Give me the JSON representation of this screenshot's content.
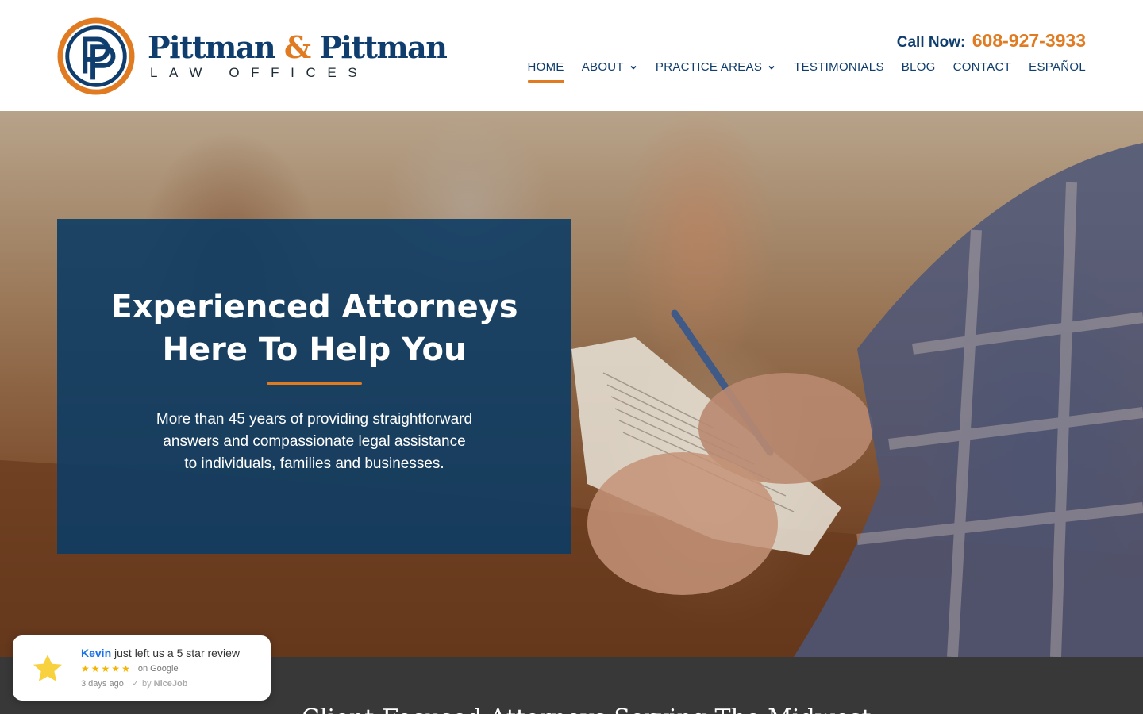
{
  "brand": {
    "name_part1": "Pittman",
    "name_amp": "&",
    "name_part2": "Pittman",
    "subtitle": "LAW OFFICES",
    "logo_letters": "PP",
    "colors": {
      "navy": "#0f3e6e",
      "orange": "#e07b22"
    }
  },
  "header": {
    "call_label": "Call Now:",
    "call_number": "608-927-3933"
  },
  "nav": {
    "items": [
      {
        "label": "HOME",
        "active": true,
        "has_dropdown": false
      },
      {
        "label": "ABOUT",
        "active": false,
        "has_dropdown": true
      },
      {
        "label": "PRACTICE AREAS",
        "active": false,
        "has_dropdown": true
      },
      {
        "label": "TESTIMONIALS",
        "active": false,
        "has_dropdown": false
      },
      {
        "label": "BLOG",
        "active": false,
        "has_dropdown": false
      },
      {
        "label": "CONTACT",
        "active": false,
        "has_dropdown": false
      },
      {
        "label": "ESPAÑOL",
        "active": false,
        "has_dropdown": false
      }
    ]
  },
  "hero": {
    "title": "Experienced Attorneys Here To Help You",
    "description": "More than 45 years of providing straightforward answers and compassionate legal assistance to individuals, families and businesses."
  },
  "section_next": {
    "heading": "Client-Focused Attorneys Serving The Midwest"
  },
  "review_widget": {
    "reviewer": "Kevin",
    "message": "just left us a 5 star review",
    "rating": 5,
    "source": "on Google",
    "time": "3 days ago",
    "by_label": "by",
    "provider": "NiceJob"
  },
  "icons": {
    "logo": "pp-monogram-logo",
    "dropdown": "chevron-down-icon",
    "review_badge": "star-icon",
    "verified": "check-icon"
  }
}
